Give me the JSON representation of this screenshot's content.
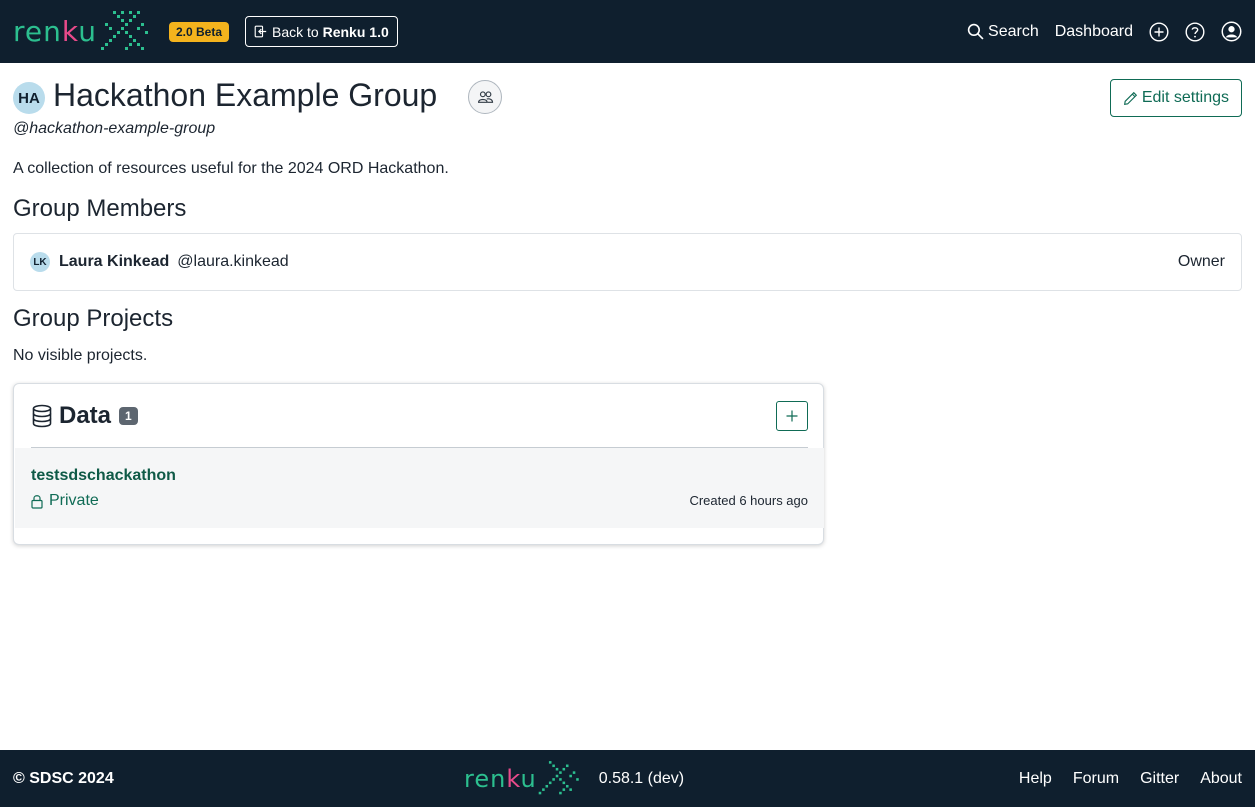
{
  "navbar": {
    "logo_text_a": "ren",
    "logo_text_k": "k",
    "logo_text_b": "u",
    "beta_badge": "2.0 Beta",
    "back_prefix": "Back to ",
    "back_bold": "Renku 1.0",
    "search_label": "Search",
    "dashboard_label": "Dashboard"
  },
  "group": {
    "initials": "HA",
    "title": "Hackathon Example Group",
    "slug": "@hackathon-example-group",
    "edit_label": "Edit settings",
    "description": "A collection of resources useful for the 2024 ORD Hackathon."
  },
  "members": {
    "heading": "Group Members",
    "items": [
      {
        "initials": "LK",
        "name": "Laura Kinkead",
        "handle": "@laura.kinkead",
        "role": "Owner"
      }
    ]
  },
  "projects": {
    "heading": "Group Projects",
    "empty_text": "No visible projects."
  },
  "data": {
    "title": "Data",
    "count": "1",
    "items": [
      {
        "name": "testsdschackathon",
        "visibility": "Private",
        "created": "Created 6 hours ago"
      }
    ]
  },
  "footer": {
    "copyright": "© SDSC 2024",
    "version": "0.58.1 (dev)",
    "links": [
      "Help",
      "Forum",
      "Gitter",
      "About"
    ]
  },
  "colors": {
    "navbar_bg": "#0f1f2e",
    "brand_green": "#2cbf8f",
    "accent_dark_green": "#0f6b55",
    "beta_yellow": "#f4b31d"
  }
}
